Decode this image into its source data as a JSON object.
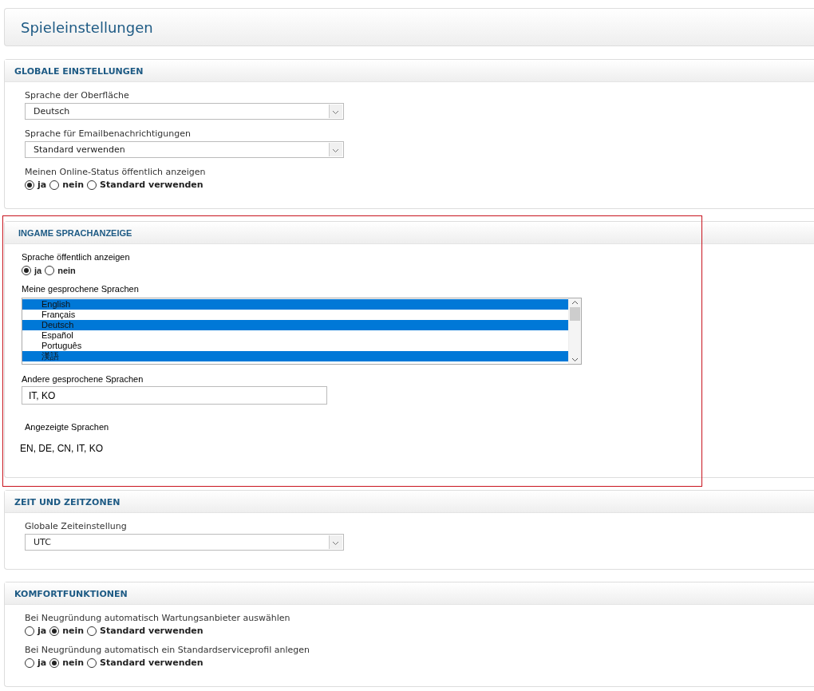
{
  "page_title": "Spieleinstellungen",
  "sections": [
    {
      "title": "GLOBALE EINSTELLUNGEN",
      "highlighted": false,
      "fields": [
        {
          "kind": "select",
          "label": "Sprache der Oberfläche",
          "value": "Deutsch"
        },
        {
          "kind": "select",
          "label": "Sprache für Emailbenachrichtigungen",
          "value": "Standard verwenden"
        },
        {
          "kind": "radio",
          "label": "Meinen Online-Status öffentlich anzeigen",
          "options": [
            {
              "label": "ja",
              "selected": true
            },
            {
              "label": "nein",
              "selected": false
            },
            {
              "label": "Standard verwenden",
              "selected": false
            }
          ]
        }
      ]
    },
    {
      "title": "INGAME SPRACHANZEIGE",
      "highlighted": true,
      "fields": [
        {
          "kind": "radio",
          "label": "Sprache öffentlich anzeigen",
          "options": [
            {
              "label": "ja",
              "selected": true
            },
            {
              "label": "nein",
              "selected": false
            }
          ]
        },
        {
          "kind": "listbox",
          "label": "Meine gesprochene Sprachen",
          "items": [
            {
              "label": "English",
              "selected": true
            },
            {
              "label": "Français",
              "selected": false
            },
            {
              "label": "Deutsch",
              "selected": true
            },
            {
              "label": "Español",
              "selected": false
            },
            {
              "label": "Português",
              "selected": false
            },
            {
              "label": "漢語",
              "selected": true
            }
          ]
        },
        {
          "kind": "input",
          "label": "Andere gesprochene Sprachen",
          "value": "IT, KO"
        },
        {
          "kind": "text",
          "label": "Angezeigte Sprachen",
          "value": "EN, DE, CN, IT, KO"
        }
      ]
    },
    {
      "title": "ZEIT UND ZEITZONEN",
      "highlighted": false,
      "fields": [
        {
          "kind": "select",
          "label": "Globale Zeiteinstellung",
          "value": "UTC"
        }
      ]
    },
    {
      "title": "KOMFORTFUNKTIONEN",
      "highlighted": false,
      "fields": [
        {
          "kind": "radio",
          "label": "Bei Neugründung automatisch Wartungsanbieter auswählen",
          "options": [
            {
              "label": "ja",
              "selected": false
            },
            {
              "label": "nein",
              "selected": true
            },
            {
              "label": "Standard verwenden",
              "selected": false
            }
          ]
        },
        {
          "kind": "radio",
          "label": "Bei Neugründung automatisch ein Standardserviceprofil anlegen",
          "options": [
            {
              "label": "ja",
              "selected": false
            },
            {
              "label": "nein",
              "selected": true
            },
            {
              "label": "Standard verwenden",
              "selected": false
            }
          ]
        }
      ]
    }
  ]
}
